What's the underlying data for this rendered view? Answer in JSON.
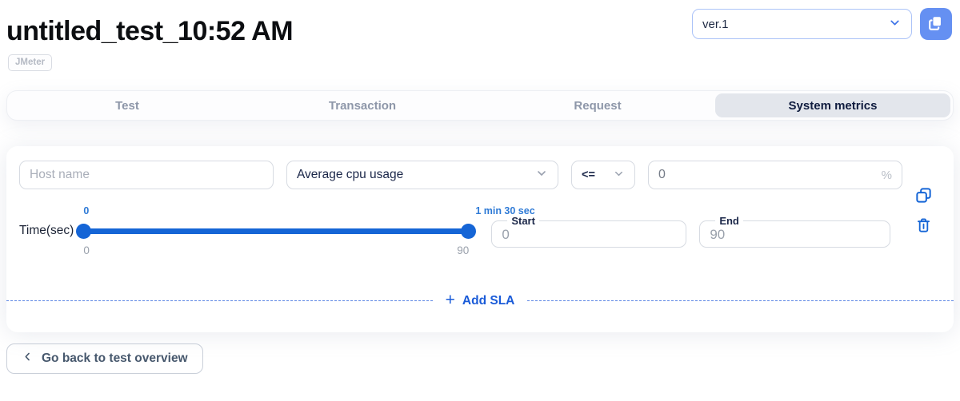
{
  "header": {
    "title": "untitled_test_10:52 AM",
    "badge": "JMeter",
    "version_select": {
      "value": "ver.1"
    }
  },
  "tabs": [
    {
      "label": "Test"
    },
    {
      "label": "Transaction"
    },
    {
      "label": "Request"
    },
    {
      "label": "System metrics",
      "active": true
    }
  ],
  "sla_form": {
    "host_input": {
      "placeholder": "Host name",
      "value": ""
    },
    "metric_select": {
      "value": "Average cpu usage"
    },
    "operator_select": {
      "value": "<="
    },
    "threshold_input": {
      "value": "0",
      "unit": "%"
    },
    "time_slider": {
      "label": "Time(sec)",
      "min_label_top": "0",
      "max_label_top": "1 min 30 sec",
      "min_label_bottom": "0",
      "max_label_bottom": "90"
    },
    "start_field": {
      "label": "Start",
      "value": "0"
    },
    "end_field": {
      "label": "End",
      "value": "90"
    }
  },
  "add_sla": {
    "plus": "+",
    "label": "Add SLA"
  },
  "back_button": {
    "chevron_icon": "chevron-left-icon",
    "label": "Go back to test overview"
  },
  "icons": [
    "copy-icon",
    "chevron-down-icon",
    "duplicate-icon",
    "trash-icon",
    "plus-icon",
    "chevron-left-icon"
  ],
  "colors": {
    "accent_blue": "#1565d6",
    "button_blue": "#6590f2",
    "select_border_blue": "#abc3f8",
    "active_tab_bg": "#e3e6ec",
    "dark_text": "#101c3f",
    "muted_text": "#8e97a9",
    "field_border": "#d7dbe2"
  }
}
